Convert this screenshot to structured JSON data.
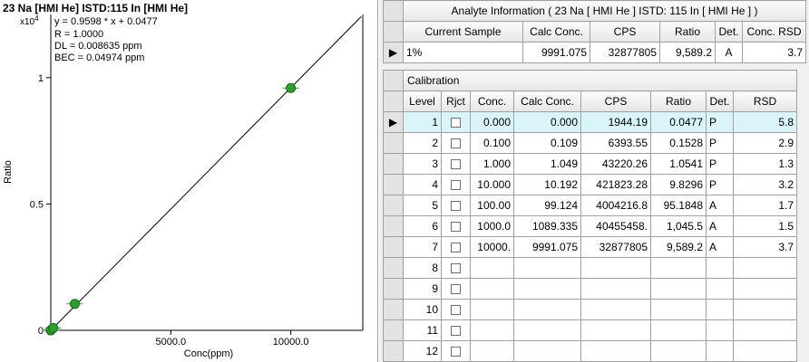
{
  "chart": {
    "title": "23 Na [HMI He] ISTD:115 In [HMI He]",
    "multiplier": "x10",
    "multiplier_exp": "4",
    "equation": "y = 0.9598 * x  + 0.0477",
    "r_value": "R = 1.0000",
    "dl": "DL = 0.008635 ppm",
    "bec": "BEC = 0.04974 ppm",
    "xlabel": "Conc(ppm)",
    "ylabel": "Ratio",
    "x_ticks": [
      "5000.0",
      "10000.0"
    ],
    "y_ticks": [
      "0",
      "0.5",
      "1"
    ],
    "line_color": "#000000",
    "point_color": "#2e9e2e"
  },
  "chart_data": {
    "type": "scatter",
    "x_unit": "ppm",
    "y_scale_factor": 10000,
    "xlim": [
      0,
      13000
    ],
    "ylim": [
      0,
      1.25
    ],
    "x_tick_values": [
      5000,
      10000
    ],
    "y_tick_values": [
      0,
      0.5,
      1
    ],
    "fit": {
      "slope": 0.9598,
      "intercept": 0.0477,
      "R": 1.0
    },
    "points": [
      {
        "x": 0.0,
        "y": 4.8e-06
      },
      {
        "x": 0.1,
        "y": 1.528e-05
      },
      {
        "x": 1.0,
        "y": 0.00010541
      },
      {
        "x": 10.0,
        "y": 0.00098296
      },
      {
        "x": 100.0,
        "y": 0.00951848
      },
      {
        "x": 1000.0,
        "y": 0.10455
      },
      {
        "x": 10000.0,
        "y": 0.95892
      }
    ],
    "grid": false
  },
  "analyte": {
    "title": "Analyte Information ( 23  Na  [ HMI He ]  ISTD: 115  In  [ HMI He ] )",
    "columns": [
      "Current Sample",
      "Calc Conc.",
      "CPS",
      "Ratio",
      "Det.",
      "Conc. RSD"
    ],
    "row": {
      "marker": "▶",
      "sample": "1%",
      "calc": "9991.075",
      "cps": "32877805",
      "ratio": "9,589.2",
      "det": "A",
      "rsd": "3.7"
    }
  },
  "calibration": {
    "title": "Calibration",
    "columns": [
      "Level",
      "Rjct",
      "Conc.",
      "Calc Conc.",
      "CPS",
      "Ratio",
      "Det.",
      "RSD"
    ],
    "selected_marker": "▶",
    "rows": [
      {
        "level": "1",
        "conc": "0.000",
        "calc": "0.000",
        "cps": "1944.19",
        "ratio": "0.0477",
        "det": "P",
        "rsd": "5.8"
      },
      {
        "level": "2",
        "conc": "0.100",
        "calc": "0.109",
        "cps": "6393.55",
        "ratio": "0.1528",
        "det": "P",
        "rsd": "2.9"
      },
      {
        "level": "3",
        "conc": "1.000",
        "calc": "1.049",
        "cps": "43220.26",
        "ratio": "1.0541",
        "det": "P",
        "rsd": "1.3"
      },
      {
        "level": "4",
        "conc": "10.000",
        "calc": "10.192",
        "cps": "421823.28",
        "ratio": "9.8296",
        "det": "P",
        "rsd": "3.2"
      },
      {
        "level": "5",
        "conc": "100.00",
        "calc": "99.124",
        "cps": "4004216.8",
        "ratio": "95.1848",
        "det": "A",
        "rsd": "1.7"
      },
      {
        "level": "6",
        "conc": "1000.0",
        "calc": "1089.335",
        "cps": "40455458.",
        "ratio": "1,045.5",
        "det": "A",
        "rsd": "1.5"
      },
      {
        "level": "7",
        "conc": "10000.",
        "calc": "9991.075",
        "cps": "32877805",
        "ratio": "9,589.2",
        "det": "A",
        "rsd": "3.7"
      },
      {
        "level": "8",
        "conc": "",
        "calc": "",
        "cps": "",
        "ratio": "",
        "det": "",
        "rsd": ""
      },
      {
        "level": "9",
        "conc": "",
        "calc": "",
        "cps": "",
        "ratio": "",
        "det": "",
        "rsd": ""
      },
      {
        "level": "10",
        "conc": "",
        "calc": "",
        "cps": "",
        "ratio": "",
        "det": "",
        "rsd": ""
      },
      {
        "level": "11",
        "conc": "",
        "calc": "",
        "cps": "",
        "ratio": "",
        "det": "",
        "rsd": ""
      },
      {
        "level": "12",
        "conc": "",
        "calc": "",
        "cps": "",
        "ratio": "",
        "det": "",
        "rsd": ""
      }
    ]
  }
}
